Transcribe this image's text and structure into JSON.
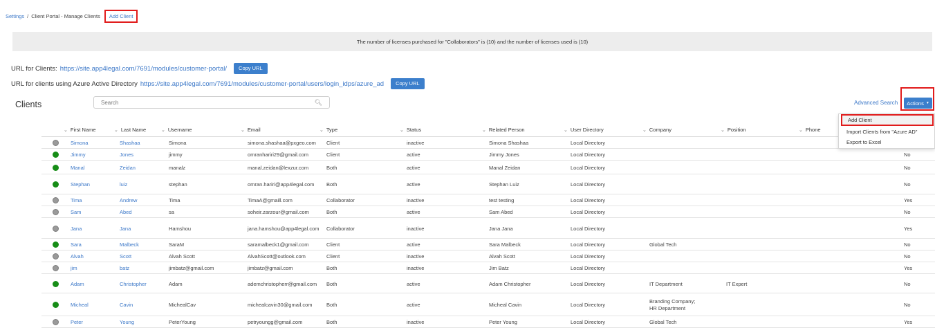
{
  "breadcrumb": {
    "settings": "Settings",
    "separator": "/",
    "current": "Client Portal - Manage Clients",
    "add_client": "Add Client"
  },
  "license_banner": "The number of licenses purchased for \"Collaborators\" is (10) and the number of licenses used is (10)",
  "url_clients": {
    "label": "URL for Clients:",
    "value": "https://site.app4legal.com/7691/modules/customer-portal/",
    "button": "Copy URL"
  },
  "url_azure": {
    "label": "URL for clients using Azure Active Directory",
    "value": "https://site.app4legal.com/7691/modules/customer-portal/users/login_idps/azure_ad",
    "button": "Copy URL"
  },
  "clients_title": "Clients",
  "search": {
    "placeholder": "Search",
    "icon": "search-icon"
  },
  "advanced_search": "Advanced Search",
  "actions": {
    "label": "Actions",
    "menu": [
      "Add Client",
      "Import Clients from \"Azure AD\"",
      "Export to Excel"
    ]
  },
  "table": {
    "columns": [
      "First Name",
      "Last Name",
      "Username",
      "Email",
      "Type",
      "Status",
      "Related Person",
      "User Directory",
      "Company",
      "Position",
      "Phone"
    ],
    "rows": [
      {
        "status_color": "grey",
        "first": "Simona",
        "last": "Shashaa",
        "username": "Simona",
        "email": "simona.shashaa@pxgeo.com",
        "type": "Client",
        "status": "inactive",
        "related": "Simona Shashaa",
        "directory": "Local Directory",
        "company": "",
        "position": "",
        "flag": ""
      },
      {
        "status_color": "green",
        "first": "Jimmy",
        "last": "Jones",
        "username": "jimmy",
        "email": "omranhariri29@gmail.com",
        "type": "Client",
        "status": "active",
        "related": "Jimmy Jones",
        "directory": "Local Directory",
        "company": "",
        "position": "",
        "flag": "No"
      },
      {
        "status_color": "green",
        "first": "Manal",
        "last": "Zeidan",
        "username": "manalz",
        "email": "manal.zeidan@lexzur.com",
        "type": "Both",
        "status": "active",
        "related": "Manal Zeidan",
        "directory": "Local Directory",
        "company": "",
        "position": "",
        "flag": "No"
      },
      {
        "status_color": "green",
        "first": "Stephan",
        "last": "luiz",
        "username": "stephan",
        "email": "omran.hariri@app4legal.com",
        "type": "Both",
        "status": "active",
        "related": "Stephan Luiz",
        "directory": "Local Directory",
        "company": "",
        "position": "",
        "flag": "No"
      },
      {
        "status_color": "grey",
        "first": "Tima",
        "last": "Andrew",
        "username": "Tima",
        "email": "TimaA@gmaill.com",
        "type": "Collaborator",
        "status": "inactive",
        "related": "test testing",
        "directory": "Local Directory",
        "company": "",
        "position": "",
        "flag": "Yes"
      },
      {
        "status_color": "grey",
        "first": "Sam",
        "last": "Abed",
        "username": "sa",
        "email": "soheir.zarzour@gmail.com",
        "type": "Both",
        "status": "active",
        "related": "Sam Abed",
        "directory": "Local Directory",
        "company": "",
        "position": "",
        "flag": "No"
      },
      {
        "status_color": "grey",
        "first": "Jana",
        "last": "Jana",
        "username": "Hamshou",
        "email": "jana.hamshou@app4legal.com",
        "type": "Collaborator",
        "status": "inactive",
        "related": "Jana Jana",
        "directory": "Local Directory",
        "company": "",
        "position": "",
        "flag": "Yes"
      },
      {
        "status_color": "green",
        "first": "Sara",
        "last": "Malbeck",
        "username": "SaraM",
        "email": "saramalbeck1@gmail.com",
        "type": "Client",
        "status": "active",
        "related": "Sara Malbeck",
        "directory": "Local Directory",
        "company": "Global Tech",
        "position": "",
        "flag": "No"
      },
      {
        "status_color": "grey",
        "first": "Alvah",
        "last": "Scott",
        "username": "Alvah Scott",
        "email": "AlvahScott@outlook.com",
        "type": "Client",
        "status": "inactive",
        "related": "Alvah Scott",
        "directory": "Local Directory",
        "company": "",
        "position": "",
        "flag": "No"
      },
      {
        "status_color": "grey",
        "first": "jim",
        "last": "batz",
        "username": "jimbatz@gmail.com",
        "email": "jimbatz@gmail.com",
        "type": "Both",
        "status": "inactive",
        "related": "Jim Batz",
        "directory": "Local Directory",
        "company": "",
        "position": "",
        "flag": "Yes"
      },
      {
        "status_color": "green",
        "first": "Adam",
        "last": "Christopher",
        "username": "Adam",
        "email": "ademchristopherr@gmail.com",
        "type": "Both",
        "status": "active",
        "related": "Adam Christopher",
        "directory": "Local Directory",
        "company": "IT Department",
        "position": "IT Expert",
        "flag": "No"
      },
      {
        "status_color": "green",
        "first": "Micheal",
        "last": "Cavin",
        "username": "MichealCav",
        "email": "michealcavin30@gmail.com",
        "type": "Both",
        "status": "active",
        "related": "Micheal Cavin",
        "directory": "Local Directory",
        "company": "Branding Company;",
        "company2": "HR Department",
        "position": "",
        "flag": "No"
      },
      {
        "status_color": "grey",
        "first": "Peter",
        "last": "Young",
        "username": "PeterYoung",
        "email": "petryoungg@gmail.com",
        "type": "Both",
        "status": "inactive",
        "related": "Peter Young",
        "directory": "Local Directory",
        "company": "Global Tech",
        "position": "",
        "flag": "Yes"
      }
    ]
  }
}
